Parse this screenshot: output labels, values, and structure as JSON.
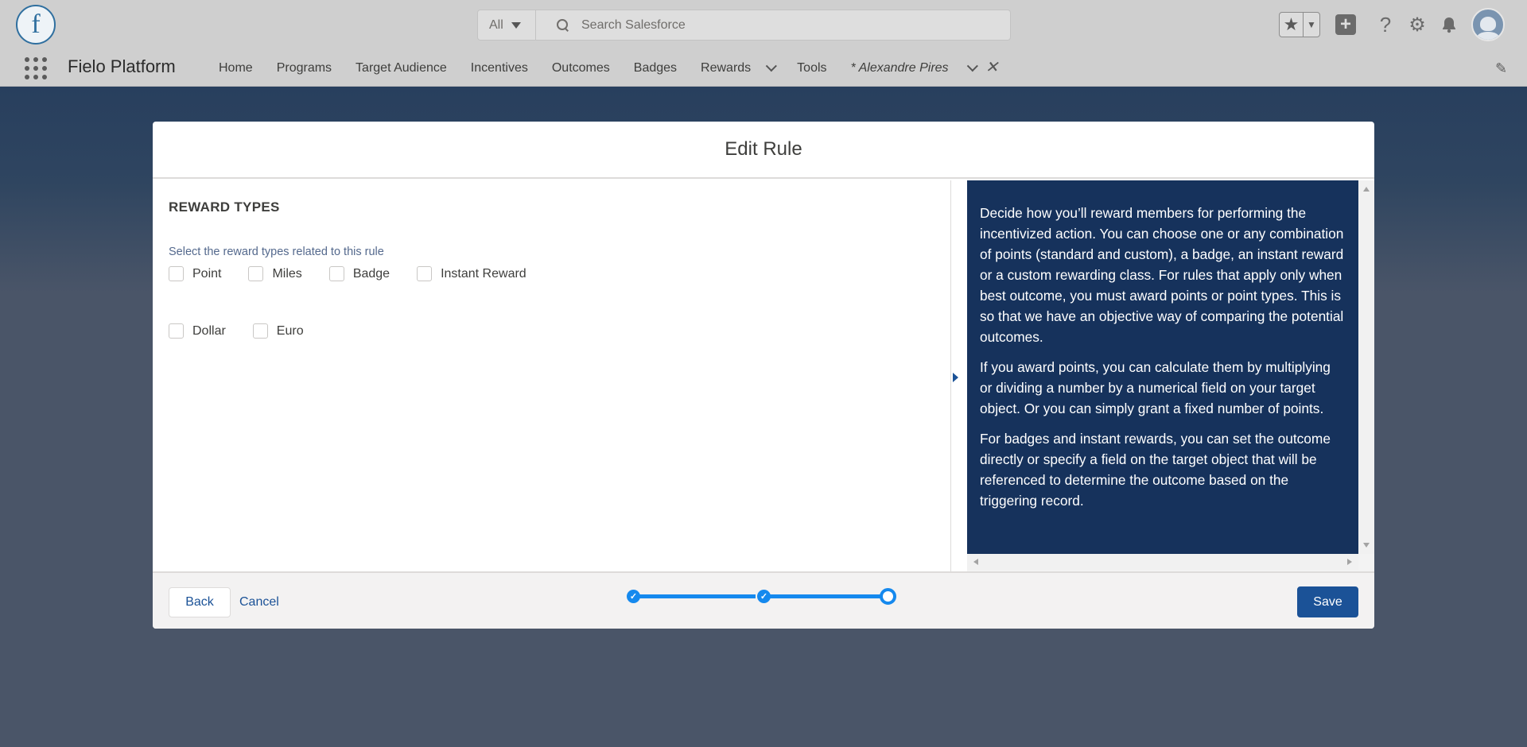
{
  "global_header": {
    "logo_letter": "f",
    "search_scope": "All",
    "search_placeholder": "Search Salesforce",
    "icons": [
      "star-icon",
      "chevron-down-icon",
      "add-icon",
      "help-icon",
      "gear-icon",
      "bell-icon",
      "avatar"
    ]
  },
  "nav": {
    "app_name": "Fielo Platform",
    "items": [
      {
        "label": "Home"
      },
      {
        "label": "Programs"
      },
      {
        "label": "Target Audience"
      },
      {
        "label": "Incentives"
      },
      {
        "label": "Outcomes"
      },
      {
        "label": "Badges"
      },
      {
        "label": "Rewards"
      },
      {
        "label": "Tools"
      }
    ],
    "active_tab_label": "* Alexandre Pires"
  },
  "modal": {
    "title": "Edit Rule",
    "section_title": "REWARD TYPES",
    "field_label": "Select the reward types related to this rule",
    "checkboxes": [
      {
        "label": "Point",
        "checked": false
      },
      {
        "label": "Miles",
        "checked": false
      },
      {
        "label": "Badge",
        "checked": false
      },
      {
        "label": "Instant Reward",
        "checked": false
      },
      {
        "label": "Dollar",
        "checked": false
      },
      {
        "label": "Euro",
        "checked": false
      }
    ],
    "help": {
      "paragraphs": [
        "Decide how you’ll reward members for performing the incentivized action. You can choose one or any combination of points (standard and custom), a badge, an instant reward or a custom rewarding class. For rules that apply only when best outcome, you must award points or point types. This is so that we have an objective way of comparing the potential outcomes.",
        "If you award points, you can calculate them by multiplying or dividing a number by a numerical field on your target object. Or you can simply grant a fixed number of points.",
        "For badges and instant rewards, you can set the outcome directly or specify a field on the target object that will be referenced to determine the outcome based on the triggering record."
      ]
    },
    "footer": {
      "back_label": "Back",
      "cancel_label": "Cancel",
      "save_label": "Save",
      "steps_total": 3,
      "current_step": 3
    }
  },
  "colors": {
    "brand_blue": "#1b5297",
    "help_panel_bg": "#16325c",
    "progress_blue": "#1589ee"
  }
}
